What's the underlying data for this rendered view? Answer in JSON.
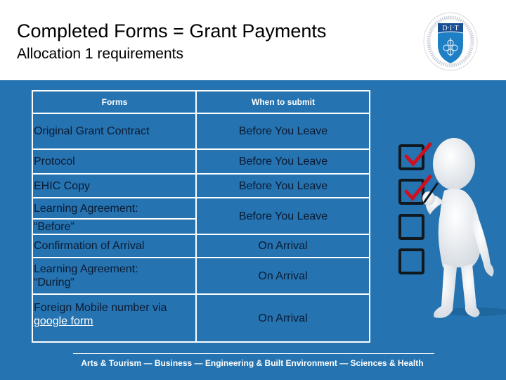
{
  "header": {
    "title": "Completed Forms = Grant Payments",
    "subtitle": "Allocation 1 requirements",
    "logo_text": "D·I·T",
    "logo_icon": "dit-crest-logo"
  },
  "table": {
    "columns": [
      "Forms",
      "When to submit"
    ],
    "rows": [
      {
        "form": "Original Grant Contract",
        "when": "Before You Leave"
      },
      {
        "form": "Protocol",
        "when": "Before You Leave"
      },
      {
        "form": "EHIC Copy",
        "when": "Before You Leave"
      },
      {
        "form_line1": "Learning Agreement:",
        "form_line2": "“Before”",
        "when": "Before You Leave"
      },
      {
        "form": "Confirmation of Arrival",
        "when": "On Arrival"
      },
      {
        "form_line1": "Learning Agreement:",
        "form_line2": "“During”",
        "when": "On Arrival"
      },
      {
        "form_line1": "Foreign Mobile number via",
        "link_text": "google form",
        "when": "On Arrival"
      }
    ]
  },
  "illustration": {
    "icon": "stick-figure-checklist-icon",
    "checkboxes": [
      true,
      true,
      false,
      false
    ]
  },
  "footer": {
    "text": "Arts & Tourism — Business — Engineering & Built Environment — Sciences & Health"
  },
  "colors": {
    "band": "#2573b0",
    "cell_text": "#0b1a33",
    "check": "#d0101e"
  }
}
